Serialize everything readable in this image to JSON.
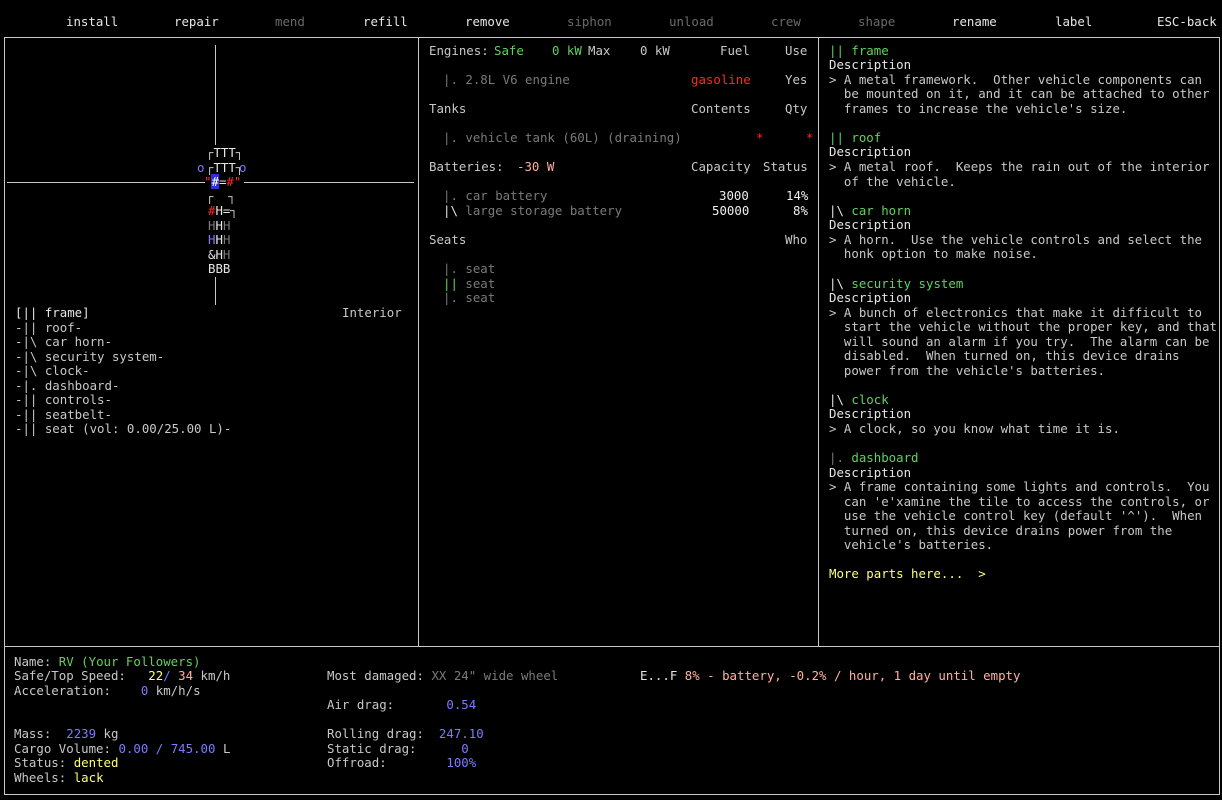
{
  "menu": {
    "items": [
      {
        "label": "install",
        "state": "active"
      },
      {
        "label": "repair",
        "state": "active"
      },
      {
        "label": "mend",
        "state": "disabled"
      },
      {
        "label": "refill",
        "state": "active"
      },
      {
        "label": "remove",
        "state": "active"
      },
      {
        "label": "siphon",
        "state": "disabled"
      },
      {
        "label": "unload",
        "state": "disabled"
      },
      {
        "label": "crew",
        "state": "disabled"
      },
      {
        "label": "shape",
        "state": "disabled"
      },
      {
        "label": "rename",
        "state": "active"
      },
      {
        "label": "label",
        "state": "active"
      },
      {
        "label": "ESC-back",
        "state": "active"
      }
    ]
  },
  "map": {
    "rows": [
      "ТТТ",
      "TTT",
      "=",
      "H=",
      "H",
      "H",
      "H",
      "BBB"
    ],
    "part_list_header": "Interior",
    "parts": [
      "[|| frame]",
      "-|| roof-",
      "-|\\ car horn-",
      "-|\\ security system-",
      "-|\\ clock-",
      "-|. dashboard-",
      "-|| controls-",
      "-|| seatbelt-",
      "-|| seat (vol: 0.00/25.00 L)-"
    ]
  },
  "engines": {
    "label": "Engines:",
    "status": "Safe",
    "kw": "0 kW",
    "max_label": "Max",
    "max_kw": "0 kW",
    "fuel_header": "Fuel",
    "use_header": "Use",
    "items": [
      {
        "name": "|. 2.8L V6 engine",
        "fuel": "gasoline",
        "use": "Yes"
      }
    ]
  },
  "tanks": {
    "label": "Tanks",
    "contents_header": "Contents",
    "qty_header": "Qty",
    "items": [
      {
        "name": "|. vehicle tank (60L) (draining)",
        "contents": "*",
        "qty": "*"
      }
    ]
  },
  "batteries": {
    "label": "Batteries:",
    "power": "-30 W",
    "capacity_header": "Capacity",
    "status_header": "Status",
    "items": [
      {
        "name": "|. car battery",
        "capacity": "3000",
        "status": "14%"
      },
      {
        "name": "|\\ large storage battery",
        "capacity": "50000",
        "status": "8%"
      }
    ]
  },
  "seats": {
    "label": "Seats",
    "who_header": "Who",
    "items": [
      "|. seat",
      "|| seat",
      "|. seat"
    ]
  },
  "descriptions": {
    "items": [
      {
        "title": "|| frame",
        "label": "Description",
        "text": [
          "> A metal framework.  Other vehicle components can",
          "  be mounted on it, and it can be attached to other",
          "  frames to increase the vehicle's size."
        ]
      },
      {
        "title": "|| roof",
        "label": "Description",
        "text": [
          "> A metal roof.  Keeps the rain out of the interior",
          "  of the vehicle."
        ]
      },
      {
        "title": "|\\ car horn",
        "label": "Description",
        "text": [
          "> A horn.  Use the vehicle controls and select the",
          "  honk option to make noise."
        ]
      },
      {
        "title": "|\\ security system",
        "label": "Description",
        "text": [
          "> A bunch of electronics that make it difficult to",
          "  start the vehicle without the proper key, and that",
          "  will sound an alarm if you try.  The alarm can be",
          "  disabled.  When turned on, this device drains",
          "  power from the vehicle's batteries."
        ]
      },
      {
        "title": "|\\ clock",
        "label": "Description",
        "text": [
          "> A clock, so you know what time it is."
        ]
      },
      {
        "title": "|. dashboard",
        "label": "Description",
        "text": [
          "> A frame containing some lights and controls.  You",
          "  can 'e'xamine the tile to access the controls, or",
          "  use the vehicle control key (default '^').  When",
          "  turned on, this device drains power from the",
          "  vehicle's batteries."
        ]
      }
    ],
    "more": "More parts here...  >"
  },
  "stats": {
    "name_label": "Name:",
    "name": "RV (Your Followers)",
    "speed_label": "Safe/Top Speed:",
    "speed_safe": "22",
    "speed_top": "34",
    "speed_unit": "km/h",
    "accel_label": "Acceleration:",
    "accel": "0",
    "accel_unit": "km/h/s",
    "mass_label": "Mass:",
    "mass": "2239",
    "mass_unit": "kg",
    "cargo_label": "Cargo Volume:",
    "cargo_used": "0.00",
    "cargo_max": "745.00",
    "cargo_unit": "L",
    "status_label": "Status:",
    "status": "dented",
    "wheels_label": "Wheels:",
    "wheels": "lack",
    "damaged_label": "Most damaged:",
    "damaged": "XX 24\" wide wheel",
    "air_label": "Air drag:",
    "air": "0.54",
    "rolling_label": "Rolling drag:",
    "rolling": "247.10",
    "static_label": "Static drag:",
    "static": "0",
    "offroad_label": "Offroad:",
    "offroad": "100%",
    "fuel_gauge_prefix": "E...F",
    "fuel_gauge_text": "8% - battery, -0.2% / hour, 1 day until empty"
  },
  "colors": {
    "green": "#5fd25f",
    "red": "#ff2828",
    "blue": "#7b7bff",
    "yellow": "#ffff78",
    "pink": "#ffb0a0",
    "gray": "#7a7a7a"
  }
}
